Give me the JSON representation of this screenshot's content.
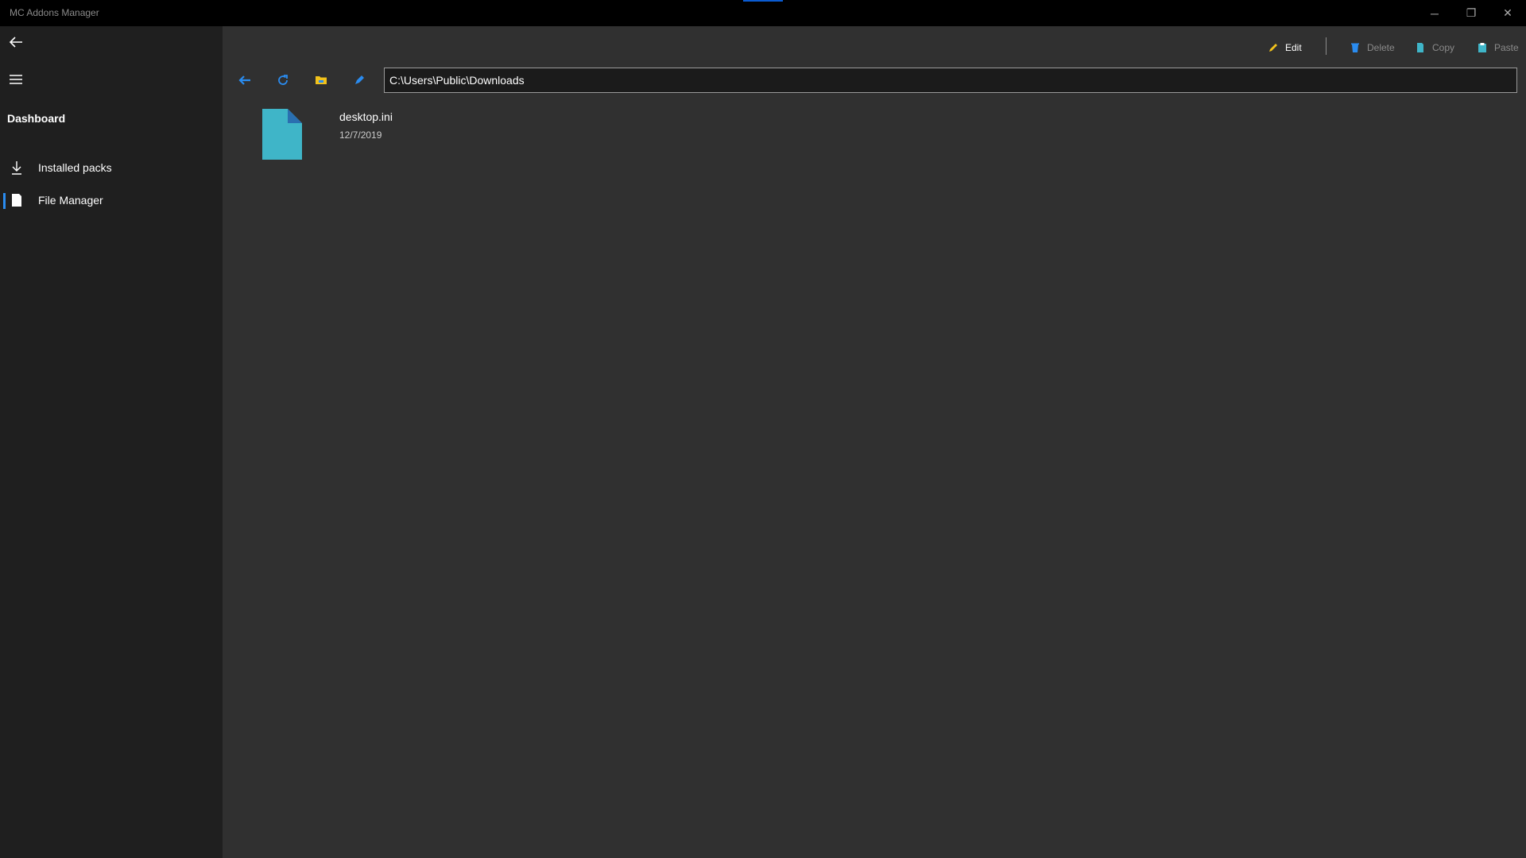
{
  "app": {
    "title": "MC Addons Manager"
  },
  "window_controls": {
    "minimize": "─",
    "maximize": "❐",
    "close": "✕"
  },
  "sidebar": {
    "back_icon": "back-arrow-icon",
    "menu_icon": "hamburger-menu-icon",
    "section_title": "Dashboard",
    "items": [
      {
        "label": "Installed packs",
        "icon": "download-icon",
        "selected": false
      },
      {
        "label": "File Manager",
        "icon": "document-icon",
        "selected": true
      }
    ]
  },
  "command_bar": {
    "edit_label": "Edit",
    "delete_label": "Delete",
    "copy_label": "Copy",
    "paste_label": "Paste"
  },
  "toolbar": {
    "back_icon": "back-arrow-icon",
    "refresh_icon": "refresh-icon",
    "folder_icon": "folder-icon",
    "brush_icon": "brush-icon"
  },
  "path": {
    "value": "C:\\Users\\Public\\Downloads"
  },
  "files": [
    {
      "name": "desktop.ini",
      "date": "12/7/2019"
    }
  ],
  "colors": {
    "accent": "#2a8cf0",
    "file_icon": "#3fb5c8",
    "folder_icon": "#f2c21b",
    "edit_icon": "#f2c21b",
    "sidebar_bg": "#1f1f1f",
    "main_bg": "#303030"
  }
}
